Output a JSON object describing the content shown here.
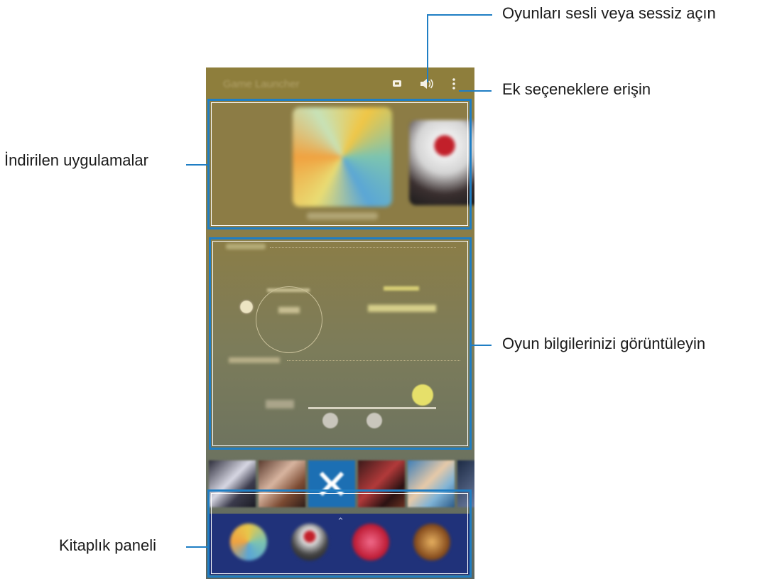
{
  "app": {
    "title": "Game Launcher"
  },
  "icons": {
    "discord": "discord-icon",
    "sound": "speaker-icon",
    "more": "more-vertical-icon"
  },
  "info": {
    "play_time_label": "Play time",
    "total_label": "Total play time",
    "total_value": "0:07",
    "last_played_label": "Last played",
    "last_played_value": "1 minute ago"
  },
  "callouts": {
    "sound": "Oyunları sesli veya sessiz açın",
    "more": "Ek seçeneklere erişin",
    "downloaded": "İndirilen uygulamalar",
    "info": "Oyun bilgilerinizi görüntüleyin",
    "library": "Kitaplık paneli"
  },
  "colors": {
    "highlight": "#1f7ec4",
    "appbar": "#8e7e3c",
    "library": "#20327a"
  }
}
